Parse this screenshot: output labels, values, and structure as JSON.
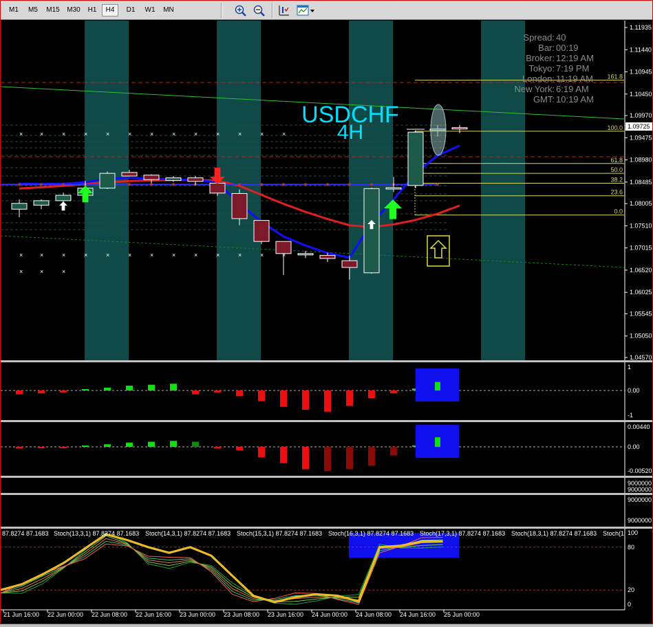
{
  "toolbar": {
    "timeframes": [
      "M1",
      "M5",
      "M15",
      "M30",
      "H1",
      "H4",
      "D1",
      "W1",
      "MN"
    ],
    "active_timeframe": "H4",
    "zoom_in_icon": "magnifier-plus-icon",
    "zoom_out_icon": "magnifier-minus-icon",
    "indicator_icon": "indicators-icon",
    "templates_icon": "chart-template-icon"
  },
  "chart": {
    "symbol": "USDCHF",
    "timeframe_label": "4H",
    "current_price": "1.09725",
    "price_axis": [
      "1.11935",
      "1.11440",
      "1.10945",
      "1.10450",
      "1.09970",
      "1.09475",
      "1.08980",
      "1.08485",
      "1.08005",
      "1.07510",
      "1.07015",
      "1.06520",
      "1.06025",
      "1.05545",
      "1.05050",
      "1.04570"
    ],
    "fib_levels": [
      {
        "label": "161.8",
        "price": 1.1076
      },
      {
        "label": "100.0",
        "price": 1.0962
      },
      {
        "label": "61.8",
        "price": 1.089
      },
      {
        "label": "50.0",
        "price": 1.0868
      },
      {
        "label": "38.2",
        "price": 1.0846
      },
      {
        "label": "23.6",
        "price": 1.0818
      },
      {
        "label": "0.0",
        "price": 1.0775
      }
    ],
    "info_panel": [
      {
        "label": "Spread:",
        "value": "40"
      },
      {
        "label": "Bar:",
        "value": "00:19"
      },
      {
        "label": "Broker:",
        "value": "12:19 AM"
      },
      {
        "label": "Tokyo:",
        "value": "7:19 PM"
      },
      {
        "label": "London:",
        "value": "11:19 AM"
      },
      {
        "label": "New York:",
        "value": "6:19 AM"
      },
      {
        "label": "GMT:",
        "value": "10:19 AM"
      }
    ],
    "candles": [
      {
        "o": 1.0788,
        "h": 1.081,
        "l": 1.077,
        "c": 1.0801
      },
      {
        "o": 1.0797,
        "h": 1.081,
        "l": 1.0788,
        "c": 1.0807
      },
      {
        "o": 1.0807,
        "h": 1.0825,
        "l": 1.0803,
        "c": 1.0819
      },
      {
        "o": 1.0819,
        "h": 1.0851,
        "l": 1.0815,
        "c": 1.0835
      },
      {
        "o": 1.0835,
        "h": 1.0872,
        "l": 1.0833,
        "c": 1.0868
      },
      {
        "o": 1.087,
        "h": 1.0876,
        "l": 1.0861,
        "c": 1.0862
      },
      {
        "o": 1.0864,
        "h": 1.0866,
        "l": 1.0846,
        "c": 1.0854
      },
      {
        "o": 1.0852,
        "h": 1.0862,
        "l": 1.0849,
        "c": 1.0858
      },
      {
        "o": 1.0858,
        "h": 1.0862,
        "l": 1.0842,
        "c": 1.085
      },
      {
        "o": 1.0846,
        "h": 1.0868,
        "l": 1.0818,
        "c": 1.0824
      },
      {
        "o": 1.0823,
        "h": 1.0832,
        "l": 1.0752,
        "c": 1.0767
      },
      {
        "o": 1.0763,
        "h": 1.0763,
        "l": 1.071,
        "c": 1.0716
      },
      {
        "o": 1.0716,
        "h": 1.0716,
        "l": 1.0641,
        "c": 1.0689
      },
      {
        "o": 1.0689,
        "h": 1.0695,
        "l": 1.0679,
        "c": 1.0689
      },
      {
        "o": 1.0685,
        "h": 1.0691,
        "l": 1.067,
        "c": 1.0678
      },
      {
        "o": 1.0673,
        "h": 1.0684,
        "l": 1.0631,
        "c": 1.0658
      },
      {
        "o": 1.0646,
        "h": 1.0836,
        "l": 1.0644,
        "c": 1.0834
      },
      {
        "o": 1.0834,
        "h": 1.086,
        "l": 1.0826,
        "c": 1.0836
      },
      {
        "o": 1.0841,
        "h": 1.0964,
        "l": 1.0835,
        "c": 1.096
      },
      {
        "o": 1.0965,
        "h": 1.0976,
        "l": 1.095,
        "c": 1.0967
      },
      {
        "o": 1.097,
        "h": 1.0976,
        "l": 1.0958,
        "c": 1.0968
      }
    ],
    "blue_ma": [
      1.0845,
      1.0844,
      1.0845,
      1.0848,
      1.0856,
      1.0858,
      1.0856,
      1.0855,
      1.0853,
      1.0848,
      1.08,
      1.076,
      1.0727,
      1.0707,
      1.069,
      1.068,
      1.0756,
      1.081,
      1.0868,
      1.0908,
      1.093
    ],
    "red_ma": [
      1.0834,
      1.0837,
      1.084,
      1.0844,
      1.0848,
      1.0851,
      1.0852,
      1.0853,
      1.0853,
      1.0852,
      1.084,
      1.082,
      1.08,
      1.0782,
      1.0766,
      1.0752,
      1.0748,
      1.0754,
      1.0764,
      1.0778,
      1.0796
    ],
    "x_labels": [
      "21 Jun 16:00",
      "22 Jun 00:00",
      "22 Jun 08:00",
      "22 Jun 16:00",
      "23 Jun 00:00",
      "23 Jun 08:00",
      "23 Jun 16:00",
      "24 Jun 00:00",
      "24 Jun 08:00",
      "24 Jun 16:00",
      "25 Jun 00:00"
    ]
  },
  "hist1": {
    "axis": [
      "1",
      "0.00",
      "-1"
    ],
    "values": [
      -0.2,
      -0.15,
      -0.1,
      0.05,
      0.15,
      0.25,
      0.3,
      0.35,
      -0.2,
      -0.1,
      -0.3,
      -0.55,
      -0.85,
      -1.0,
      -1.1,
      -0.8,
      -0.4,
      -0.15,
      0.1,
      0.3
    ]
  },
  "hist2": {
    "axis": [
      "0.00440",
      "0.00",
      "-0.00520"
    ],
    "values": [
      -0.1,
      -0.05,
      -0.03,
      0.05,
      0.15,
      0.25,
      0.3,
      0.35,
      0.3,
      -0.1,
      -0.2,
      -0.6,
      -0.95,
      -1.3,
      -1.4,
      -1.3,
      -1.1,
      -0.5,
      0.0,
      0.4
    ]
  },
  "empty1": {
    "axis": [
      "9000000",
      "9000000"
    ]
  },
  "empty2": {
    "axis": [
      "9000000",
      "9000000"
    ]
  },
  "stoch": {
    "labels": [
      "87.8274 87.1683",
      "Stoch(13,3,1) 87.8274 87.1683",
      "Stoch(14,3,1) 87.8274 87.1683",
      "Stoch(15,3,1) 87.8274 87.1683",
      "Stoch(16,3,1) 87.8274 87.1683",
      "Stoch(17,3,1) 87.8274 87.1683",
      "Stoch(18,3,1) 87.8274 87.1683",
      "Stoch(1"
    ],
    "axis": [
      "100",
      "80",
      "20",
      "0"
    ],
    "main": [
      20,
      28,
      42,
      58,
      78,
      98,
      90,
      80,
      72,
      80,
      68,
      40,
      12,
      3,
      10,
      14,
      12,
      4,
      80,
      82,
      88,
      88
    ],
    "alt": [
      16,
      22,
      36,
      52,
      70,
      92,
      84,
      62,
      58,
      62,
      50,
      22,
      8,
      5,
      8,
      10,
      9,
      6,
      78,
      80,
      86,
      87
    ]
  },
  "colors": {
    "bull": "#1e5a4a",
    "bear": "#7d1a2a",
    "session": "#0f4a48",
    "blue_ma": "#1010ff",
    "red_ma": "#e02020",
    "fib": "#d8d860",
    "symbol": "#00e0ff",
    "info": "#8a8a8a"
  }
}
